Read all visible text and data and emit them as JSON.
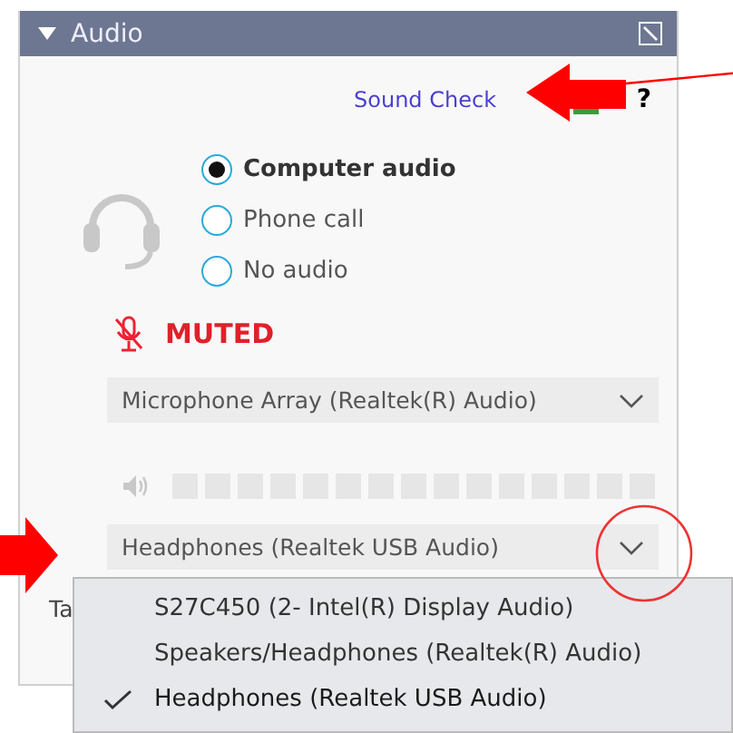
{
  "panel": {
    "title": "Audio",
    "expanded": true
  },
  "sound_check": {
    "label": "Sound Check",
    "help": "?"
  },
  "audio_options": [
    {
      "label": "Computer audio",
      "selected": true
    },
    {
      "label": "Phone call",
      "selected": false
    },
    {
      "label": "No audio",
      "selected": false
    }
  ],
  "microphone": {
    "status": "MUTED",
    "muted": true,
    "device": "Microphone Array (Realtek(R) Audio)"
  },
  "speaker": {
    "level": 0,
    "device": "Headphones (Realtek USB Audio)"
  },
  "cut_label": "Ta",
  "speaker_menu": [
    {
      "label": "S27C450 (2- Intel(R) Display Audio)",
      "selected": false
    },
    {
      "label": "Speakers/Headphones (Realtek(R) Audio)",
      "selected": false
    },
    {
      "label": "Headphones (Realtek USB Audio)",
      "selected": true
    }
  ]
}
